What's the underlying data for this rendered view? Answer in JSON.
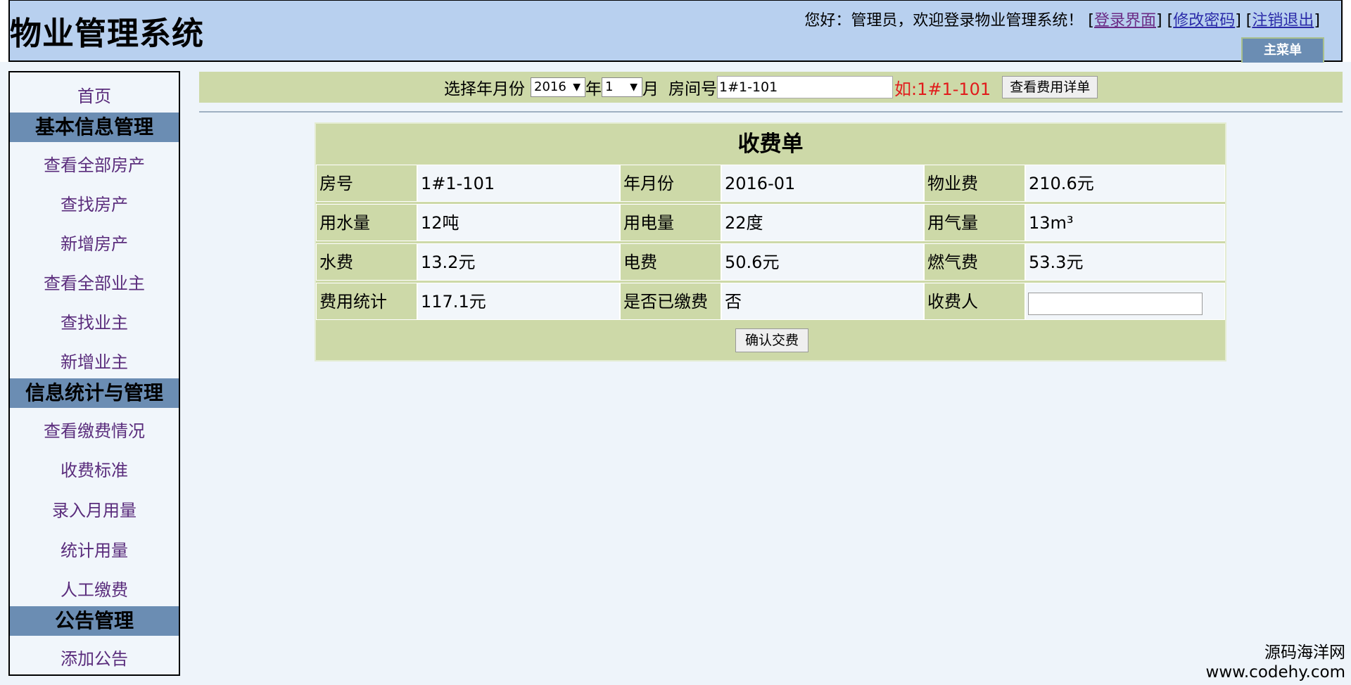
{
  "header": {
    "app_title": "物业管理系统",
    "welcome": "您好：管理员，欢迎登录物业管理系统！",
    "links": [
      {
        "label": "登录界面"
      },
      {
        "label": "修改密码"
      },
      {
        "label": "注销退出"
      }
    ],
    "main_menu": "主菜单"
  },
  "sidebar": {
    "home": "首页",
    "sections": [
      {
        "title": "基本信息管理",
        "items": [
          "查看全部房产",
          "查找房产",
          "新增房产",
          "查看全部业主",
          "查找业主",
          "新增业主"
        ]
      },
      {
        "title": "信息统计与管理",
        "items": [
          "查看缴费情况",
          "收费标准",
          "录入月用量",
          "统计用量",
          "人工缴费"
        ]
      },
      {
        "title": "公告管理",
        "items": [
          "添加公告"
        ]
      }
    ]
  },
  "search": {
    "label_month": "选择年月份",
    "year_value": "2016",
    "year_suffix": "年",
    "month_value": "1",
    "month_suffix": "月",
    "room_label": "房间号",
    "room_value": "1#1-101",
    "example": "如:1#1-101",
    "button": "查看费用详单"
  },
  "bill": {
    "title": "收费单",
    "rows": [
      [
        {
          "label": "房号",
          "value": "1#1-101"
        },
        {
          "label": "年月份",
          "value": "2016-01"
        },
        {
          "label": "物业费",
          "value": "210.6元"
        }
      ],
      [
        {
          "label": "用水量",
          "value": "12吨"
        },
        {
          "label": "用电量",
          "value": "22度"
        },
        {
          "label": "用气量",
          "value": "13m³"
        }
      ],
      [
        {
          "label": "水费",
          "value": "13.2元"
        },
        {
          "label": "电费",
          "value": "50.6元"
        },
        {
          "label": "燃气费",
          "value": "53.3元"
        }
      ],
      [
        {
          "label": "费用统计",
          "value": "117.1元"
        },
        {
          "label": "是否已缴费",
          "value": "否"
        },
        {
          "label": "收费人",
          "value": ""
        }
      ]
    ],
    "confirm": "确认交费"
  },
  "watermark": {
    "line1": "源码海洋网",
    "line2": "www.codehy.com"
  }
}
